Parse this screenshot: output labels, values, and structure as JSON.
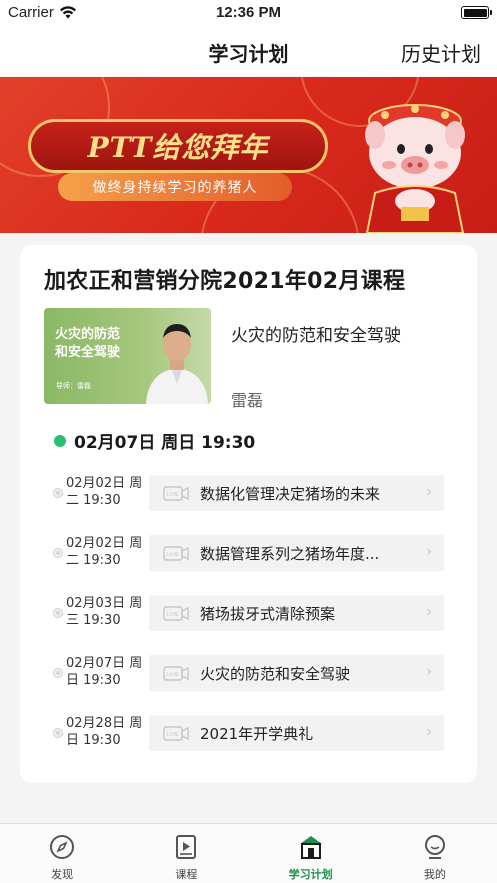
{
  "status_bar": {
    "carrier": "Carrier",
    "time": "12:36 PM"
  },
  "nav": {
    "title": "学习计划",
    "right_action": "历史计划"
  },
  "banner": {
    "headline": "PTT给您拜年",
    "slogan": "做终身持续学习的养猪人"
  },
  "card": {
    "title": "加农正和营销分院2021年02月课程",
    "featured": {
      "thumb_title_line1": "火灾的防范",
      "thumb_title_line2": "和安全驾驶",
      "thumb_lecturer": "导师：雷磊",
      "title": "火灾的防范和安全驾驶",
      "lecturer": "雷磊"
    },
    "current_time": "02月07日 周日 19:30",
    "schedule": [
      {
        "date": "02月02日 周二 19:30",
        "course": "数据化管理决定猪场的未来"
      },
      {
        "date": "02月02日 周二 19:30",
        "course": "数据管理系列之猪场年度..."
      },
      {
        "date": "02月03日 周三 19:30",
        "course": "猪场拔牙式清除预案"
      },
      {
        "date": "02月07日 周日 19:30",
        "course": "火灾的防范和安全驾驶"
      },
      {
        "date": "02月28日 周日 19:30",
        "course": "2021年开学典礼"
      }
    ]
  },
  "tabs": [
    {
      "label": "发现",
      "icon": "compass-icon",
      "active": false
    },
    {
      "label": "课程",
      "icon": "video-book-icon",
      "active": false
    },
    {
      "label": "学习计划",
      "icon": "house-plan-icon",
      "active": true
    },
    {
      "label": "我的",
      "icon": "profile-icon",
      "active": false
    }
  ],
  "colors": {
    "accent": "#1b8f4d",
    "live_dot": "#2bbf73",
    "banner_red": "#d92a1c"
  }
}
